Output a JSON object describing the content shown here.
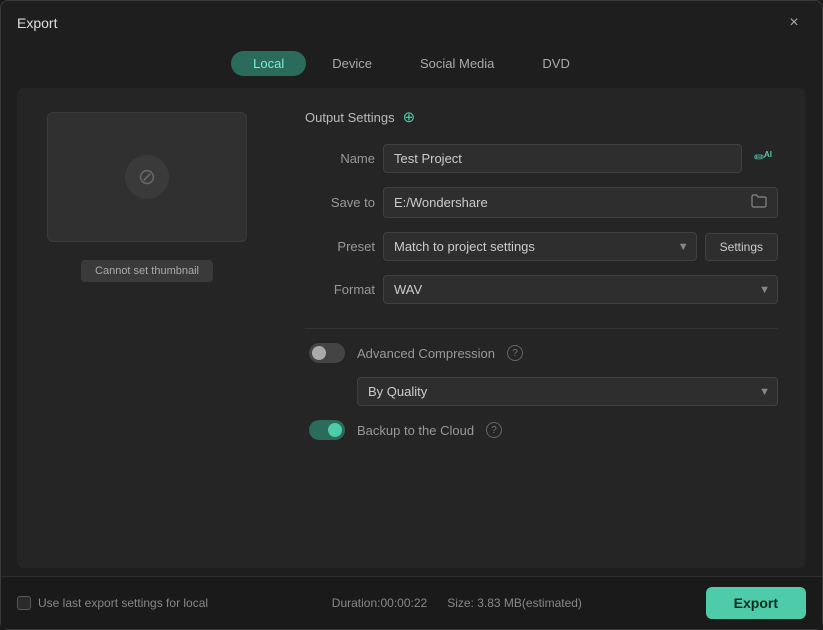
{
  "window": {
    "title": "Export",
    "close_label": "×"
  },
  "tabs": [
    {
      "id": "local",
      "label": "Local",
      "active": true
    },
    {
      "id": "device",
      "label": "Device",
      "active": false
    },
    {
      "id": "social_media",
      "label": "Social Media",
      "active": false
    },
    {
      "id": "dvd",
      "label": "DVD",
      "active": false
    }
  ],
  "preview": {
    "thumbnail_btn_label": "Cannot set thumbnail",
    "icon": "⊘"
  },
  "settings": {
    "section_title": "Output Settings",
    "name_label": "Name",
    "name_value": "Test Project",
    "save_to_label": "Save to",
    "save_to_value": "E:/Wondershare",
    "preset_label": "Preset",
    "preset_value": "Match to project settings",
    "settings_btn_label": "Settings",
    "format_label": "Format",
    "format_value": "WAV",
    "advanced_compression_label": "Advanced Compression",
    "quality_label": "Quality",
    "quality_value": "By Quality",
    "backup_label": "Backup to the Cloud"
  },
  "footer": {
    "checkbox_label": "Use last export settings for local",
    "duration_label": "Duration:00:00:22",
    "size_label": "Size: 3.83 MB(estimated)",
    "export_btn_label": "Export"
  }
}
